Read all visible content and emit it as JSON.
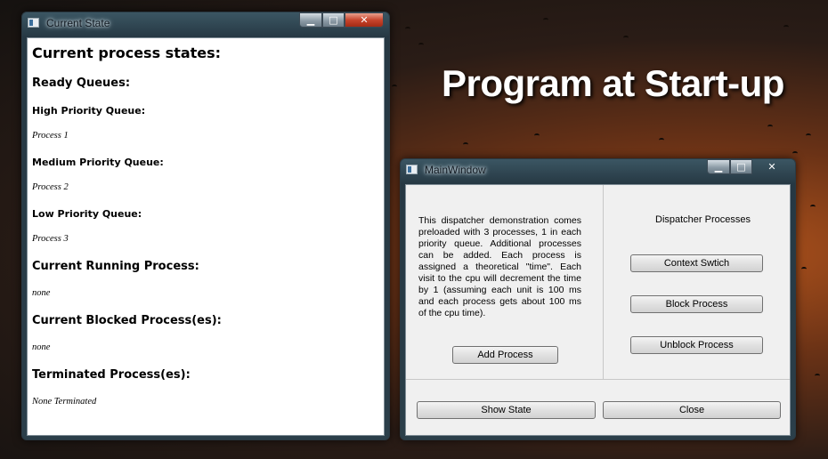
{
  "headline": "Program at Start-up",
  "current_state_window": {
    "title": "Current State",
    "heading": "Current process states:",
    "ready_queues_label": "Ready Queues:",
    "high_priority_label": "High Priority Queue:",
    "high_priority_value": "Process 1",
    "medium_priority_label": "Medium Priority Queue:",
    "medium_priority_value": "Process 2",
    "low_priority_label": "Low Priority Queue:",
    "low_priority_value": "Process 3",
    "running_label": "Current Running Process:",
    "running_value": "none",
    "blocked_label": "Current Blocked Process(es):",
    "blocked_value": "none",
    "terminated_label": "Terminated Process(es):",
    "terminated_value": "None Terminated"
  },
  "main_window": {
    "title": "MainWindow",
    "description": "This dispatcher demonstration comes preloaded with 3 processes, 1 in each priority queue. Additional processes can be added. Each process is assigned a theoretical \"time\". Each visit to the cpu will decrement the time by 1 (assuming each unit is 100 ms and each process gets about 100 ms of the cpu time).",
    "add_process_button": "Add Process",
    "dispatcher_label": "Dispatcher Processes",
    "context_switch_button": "Context Swtich",
    "block_process_button": "Block Process",
    "unblock_process_button": "Unblock Process",
    "show_state_button": "Show State",
    "close_button": "Close"
  },
  "window_controls": {
    "minimize": "▁",
    "maximize": "□",
    "close": "✕"
  },
  "icons": [
    "app-window-icon",
    "minimize-icon",
    "maximize-icon",
    "close-icon"
  ],
  "colors": {
    "background_glow": "#b5551c",
    "title_bar": "#3b5663",
    "close_button": "#c8452d",
    "client_bg": "#f0f0f0"
  }
}
